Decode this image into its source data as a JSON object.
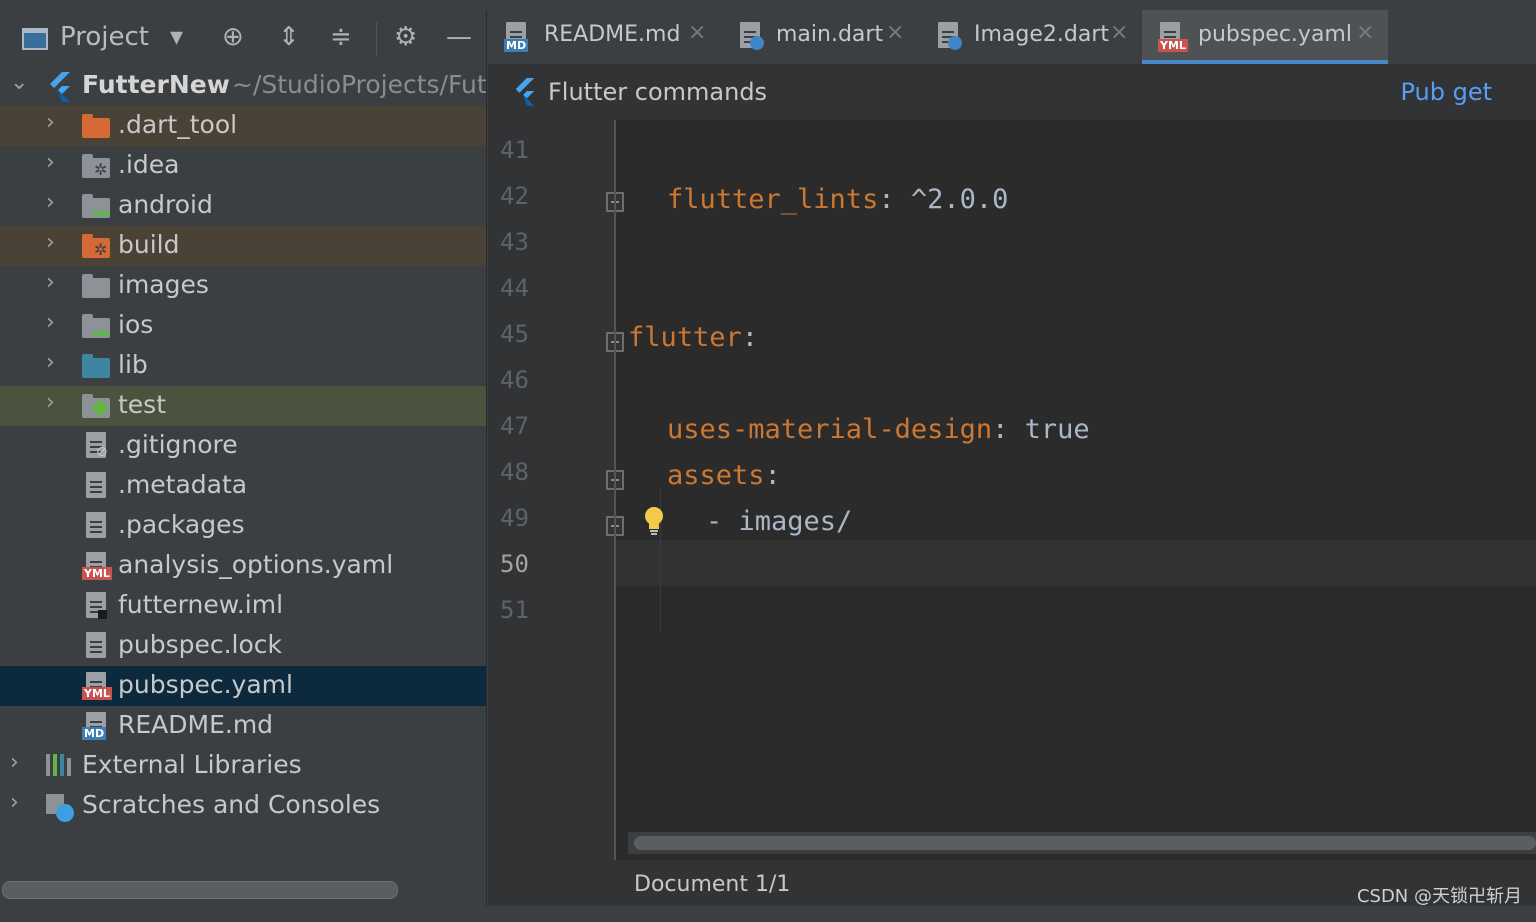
{
  "project_toolbar": {
    "title": "Project",
    "dropdown_icon": "chevron-down-icon",
    "buttons": [
      "locate-icon",
      "expand-all-icon",
      "collapse-all-icon",
      "gear-icon",
      "minimize-icon"
    ]
  },
  "tree": {
    "root": {
      "name": "FutterNew",
      "path": "~/StudioProjects/Fut"
    },
    "items": [
      {
        "label": ".dart_tool"
      },
      {
        "label": ".idea"
      },
      {
        "label": "android"
      },
      {
        "label": "build"
      },
      {
        "label": "images"
      },
      {
        "label": "ios"
      },
      {
        "label": "lib"
      },
      {
        "label": "test"
      },
      {
        "label": ".gitignore"
      },
      {
        "label": ".metadata"
      },
      {
        "label": ".packages"
      },
      {
        "label": "analysis_options.yaml"
      },
      {
        "label": "futternew.iml"
      },
      {
        "label": "pubspec.lock"
      },
      {
        "label": "pubspec.yaml"
      },
      {
        "label": "README.md"
      },
      {
        "label": "External Libraries"
      },
      {
        "label": "Scratches and Consoles"
      }
    ]
  },
  "tabs": [
    {
      "label": "README.md",
      "badge": "MD",
      "close": "×"
    },
    {
      "label": "main.dart",
      "close": "×"
    },
    {
      "label": "Image2.dart",
      "close": "×"
    },
    {
      "label": "pubspec.yaml",
      "badge": "YML",
      "close": "×"
    }
  ],
  "badges": {
    "yml": "YML",
    "md": "MD"
  },
  "commands_bar": {
    "title": "Flutter commands",
    "action": "Pub get"
  },
  "editor": {
    "line_numbers": [
      "41",
      "42",
      "43",
      "44",
      "45",
      "46",
      "47",
      "48",
      "49",
      "50",
      "51"
    ],
    "current_line": "50",
    "code": {
      "l42_key": "flutter_lints",
      "l42_val": ": ^2.0.0",
      "l45_key": "flutter",
      "l45_colon": ":",
      "l47_key": "uses-material-design",
      "l47_val": ": true",
      "l48_key": "assets",
      "l48_colon": ":",
      "l49_text": "- images/"
    }
  },
  "status": {
    "document": "Document 1/1"
  },
  "watermark": "CSDN @天锁卍斩月",
  "colors": {
    "yaml_key": "#cc7832",
    "link": "#589df6",
    "selection": "#0d293e"
  }
}
